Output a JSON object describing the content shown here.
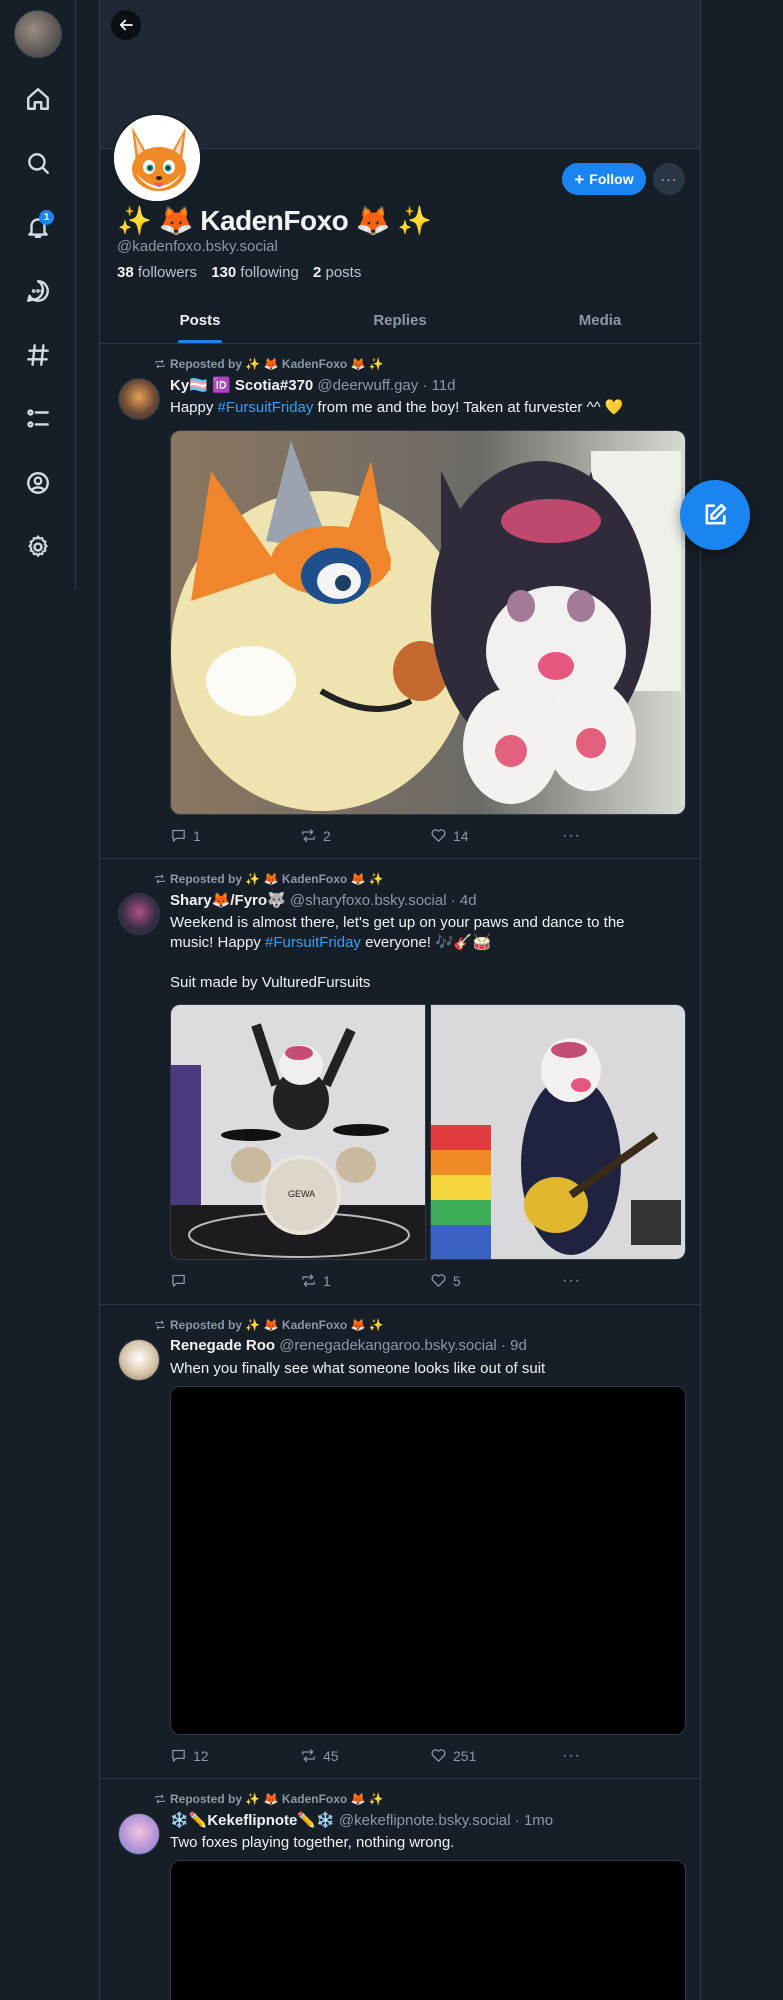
{
  "nav": {
    "notifications_badge": "1",
    "items": [
      "home",
      "search",
      "notifications",
      "chat",
      "feeds",
      "lists",
      "profile",
      "settings"
    ]
  },
  "profile": {
    "display_name": "✨ 🦊 KadenFoxo 🦊 ✨",
    "handle": "@kadenfoxo.bsky.social",
    "followers_count": "38",
    "followers_label": "followers",
    "following_count": "130",
    "following_label": "following",
    "posts_count": "2",
    "posts_label": "posts",
    "follow_label": "Follow",
    "more_label": "···"
  },
  "tabs": [
    {
      "label": "Posts",
      "active": true
    },
    {
      "label": "Replies",
      "active": false
    },
    {
      "label": "Media",
      "active": false
    }
  ],
  "posts": [
    {
      "repost_by": "Reposted by ✨ 🦊 KadenFoxo 🦊 ✨",
      "author_name": "Ky🏳️‍⚧️ 🆔 Scotia#370",
      "author_handle": "@deerwuff.gay",
      "time": "· 11d",
      "text_pre": "Happy ",
      "tag": "#FursuitFriday",
      "text_post": " from me and the boy! Taken at furvester ^^ 💛",
      "replies": "1",
      "reposts": "2",
      "likes": "14"
    },
    {
      "repost_by": "Reposted by ✨ 🦊 KadenFoxo 🦊 ✨",
      "author_name": "Shary🦊/Fyro🐺",
      "author_handle": "@sharyfoxo.bsky.social",
      "time": "· 4d",
      "text_line1": "Weekend is almost there, let's get up on your paws and dance to the",
      "text_line2_pre": "music! Happy ",
      "tag": "#FursuitFriday",
      "text_line2_post": " everyone! 🎶🎸🥁",
      "text_line3": "Suit made by VulturedFursuits",
      "replies": "",
      "reposts": "1",
      "likes": "5"
    },
    {
      "repost_by": "Reposted by ✨ 🦊 KadenFoxo 🦊 ✨",
      "author_name": "Renegade Roo",
      "author_handle": "@renegadekangaroo.bsky.social",
      "time": "· 9d",
      "text": "When you finally see what someone looks like out of suit",
      "replies": "12",
      "reposts": "45",
      "likes": "251"
    },
    {
      "repost_by": "Reposted by ✨ 🦊 KadenFoxo 🦊 ✨",
      "author_name": "❄️✏️Kekeflipnote✏️❄️",
      "author_handle": "@kekeflipnote.bsky.social",
      "time": "· 1mo",
      "text": "Two foxes playing together, nothing wrong."
    }
  ],
  "colors": {
    "background": "#161e27",
    "accent": "#1a84f0",
    "hashtag": "#3b9ef5",
    "muted": "#8a98a8",
    "border": "#2e3a48"
  }
}
